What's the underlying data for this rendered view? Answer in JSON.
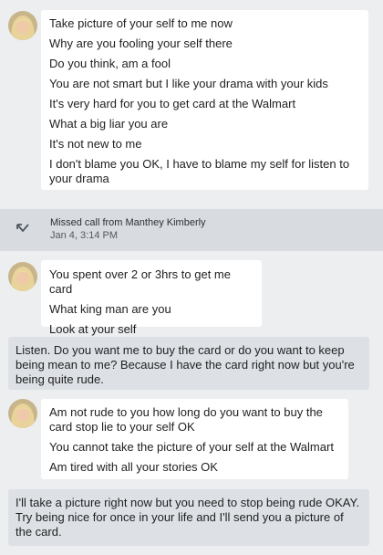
{
  "colors": {
    "background": "#edeef0",
    "incoming_bubble": "#ffffff",
    "outgoing_bubble": "#dde1e6",
    "missed_call_bar": "#d8dbe0"
  },
  "messages": [
    {
      "direction": "incoming",
      "lines": [
        "Take picture of your self to me now",
        "Why are you fooling your self there",
        "Do you think, am a fool",
        "You are not smart but I like your drama with your kids",
        "It's very hard for you to get card at the Walmart",
        "What a big liar you are",
        "It's not new to me",
        "I don't blame you OK, I have to blame my self for listen to your drama"
      ]
    },
    {
      "direction": "system",
      "icon": "missed-call-icon",
      "title": "Missed call from Manthey Kimberly",
      "time": "Jan 4, 3:14 PM"
    },
    {
      "direction": "incoming",
      "lines": [
        "You spent over 2 or 3hrs to get me card",
        "What king man are you",
        "Look at your self"
      ]
    },
    {
      "direction": "outgoing",
      "text": "Listen. Do you want me to buy the card or do you want to keep being mean to me? Because I have the card right now but you're being quite rude."
    },
    {
      "direction": "incoming",
      "lines": [
        "Am not rude to you how long do you want to buy the card stop lie to your self OK",
        "You cannot take the picture of your self at the Walmart",
        "Am tired with all your stories OK"
      ]
    },
    {
      "direction": "outgoing",
      "text": "I'll take a picture right now but you need to stop being rude OKAY. Try being nice for once in your life and I'll send you a picture of the card."
    }
  ]
}
